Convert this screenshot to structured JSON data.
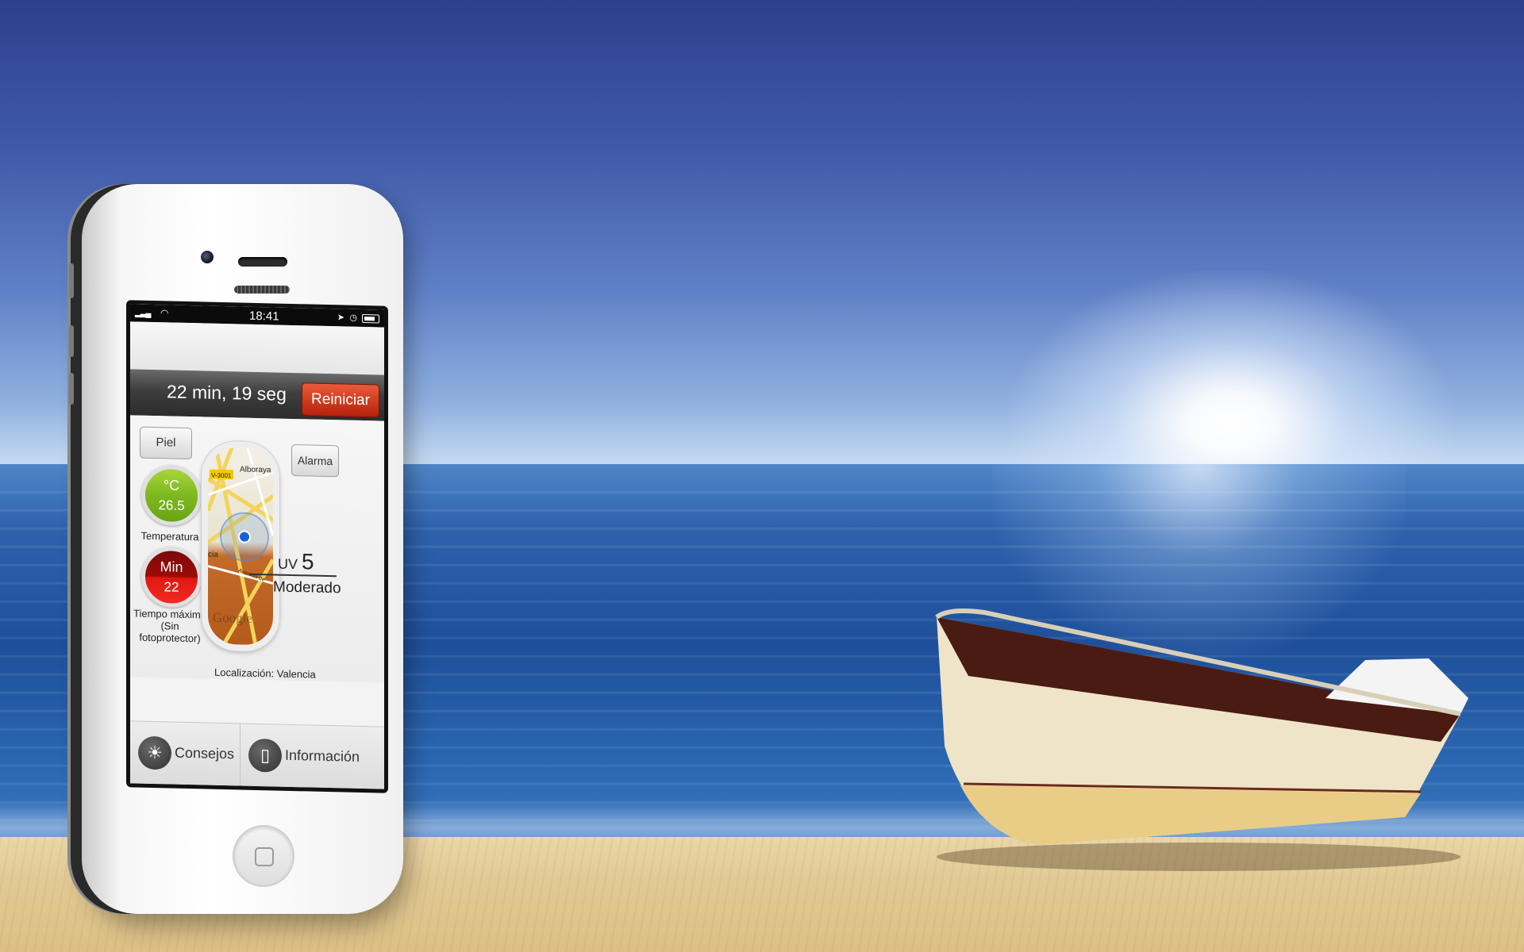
{
  "app": {
    "status_bar": {
      "time": "18:41"
    },
    "timer": {
      "text": "22 min, 19 seg",
      "reset_label": "Reiniciar"
    },
    "buttons": {
      "skin_label": "Piel",
      "alarm_label": "Alarma"
    },
    "temperature": {
      "unit": "°C",
      "value": "26.5",
      "label": "Temperatura"
    },
    "max_time": {
      "unit": "Min",
      "value": "22",
      "label_line1": "Tiempo máximo",
      "label_line2": "(Sin fotoprotector)"
    },
    "map": {
      "labels": [
        "Alboraya",
        "V-3001",
        "Avenida de",
        "cia"
      ],
      "watermark": "Google"
    },
    "uv": {
      "prefix": "UV",
      "value": "5",
      "level": "Moderado"
    },
    "location": {
      "label": "Localización:",
      "value": "Valencia"
    },
    "tabs": [
      {
        "label": "Consejos",
        "icon": "sun-icon"
      },
      {
        "label": "Información",
        "icon": "phone-icon"
      }
    ]
  },
  "colors": {
    "reset_button": "#c62a10",
    "temperature_circle": "#7eb81f",
    "min_circle": "#e11713",
    "timer_bar": "#3e3e3e"
  }
}
